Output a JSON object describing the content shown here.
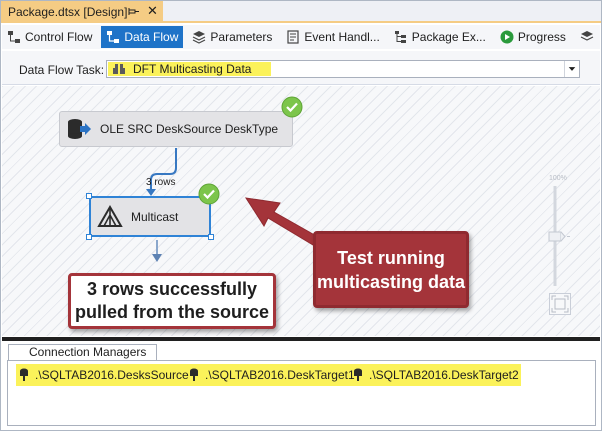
{
  "document_tab": {
    "title": "Package.dtsx [Design]",
    "pin_icon": "pin-icon",
    "close_glyph": "✕"
  },
  "designer_tabs": [
    {
      "label": "Control Flow",
      "icon": "control-flow-icon",
      "active": false
    },
    {
      "label": "Data Flow",
      "icon": "data-flow-icon",
      "active": true
    },
    {
      "label": "Parameters",
      "icon": "parameters-icon",
      "active": false
    },
    {
      "label": "Event Handl...",
      "icon": "event-handlers-icon",
      "active": false
    },
    {
      "label": "Package Ex...",
      "icon": "package-explorer-icon",
      "active": false
    },
    {
      "label": "Progress",
      "icon": "progress-icon",
      "active": false
    }
  ],
  "task_row": {
    "label": "Data Flow Task:",
    "selected": "DFT Multicasting Data"
  },
  "canvas": {
    "source_component": {
      "label": "OLE SRC DeskSource DeskType",
      "status": "success"
    },
    "multicast_component": {
      "label": "Multicast",
      "status": "success"
    },
    "path_label": "3 rows",
    "zoom_label": "100%"
  },
  "callouts": {
    "left": {
      "line1": "3 rows successfully",
      "line2": "pulled from the source"
    },
    "right": {
      "line1": "Test running",
      "line2": "multicasting data"
    }
  },
  "connection_managers": {
    "tab_label": "Connection Managers",
    "items": [
      {
        "label": ".\\SQLTAB2016.DesksSource"
      },
      {
        "label": ".\\SQLTAB2016.DeskTarget1"
      },
      {
        "label": ".\\SQLTAB2016.DeskTarget2"
      }
    ]
  },
  "colors": {
    "accent": "#1e73c8",
    "highlight": "#fbf25a",
    "callout": "#a4343a",
    "success": "#7cc54b",
    "tab_gold": "#f5cc84"
  }
}
